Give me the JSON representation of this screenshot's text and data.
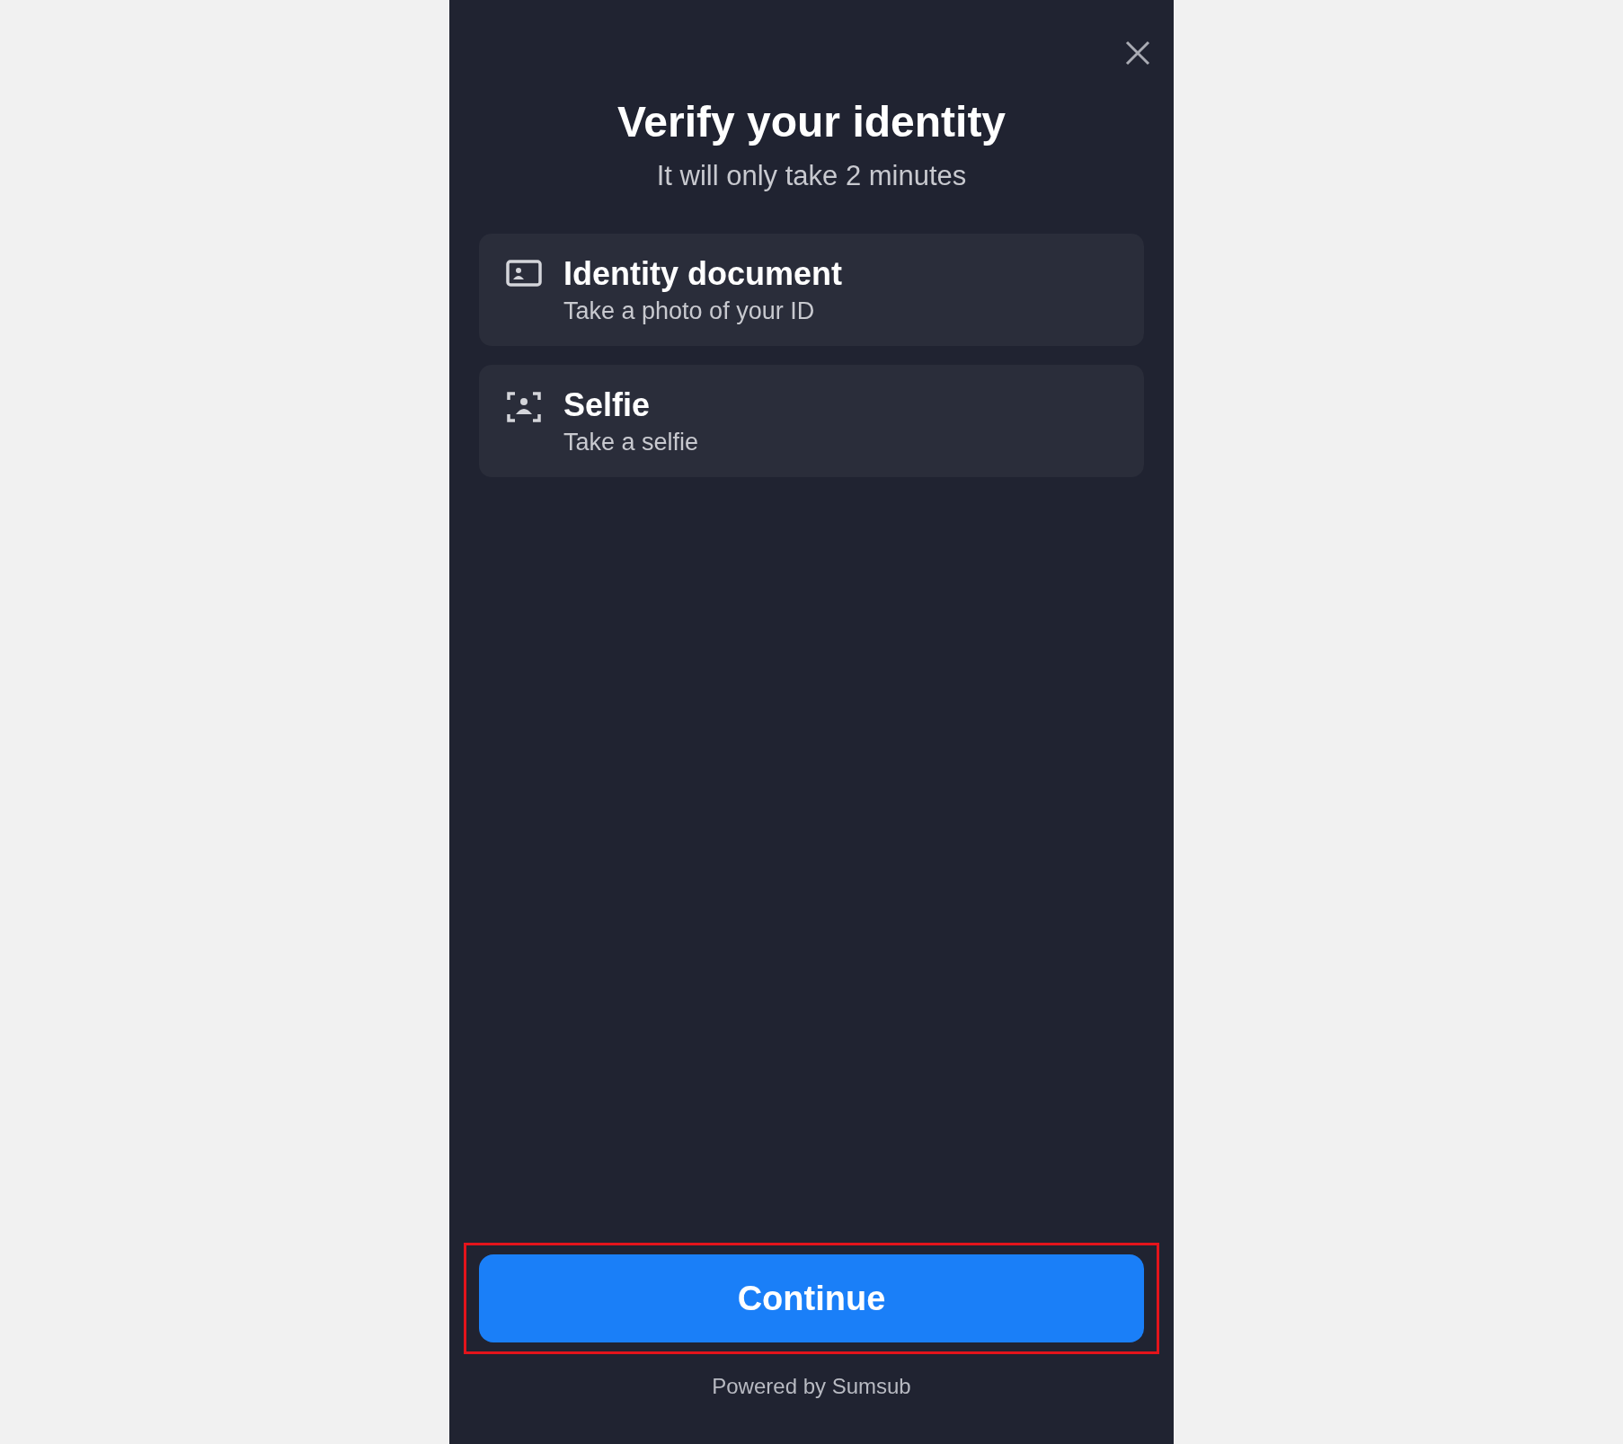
{
  "screen": {
    "title": "Verify your identity",
    "subtitle": "It will only take 2 minutes"
  },
  "steps": [
    {
      "kind": "document",
      "title": "Identity document",
      "subtitle": "Take a photo of your ID"
    },
    {
      "kind": "selfie",
      "title": "Selfie",
      "subtitle": "Take a selfie"
    }
  ],
  "primary_button": {
    "label": "Continue",
    "highlighted": true
  },
  "footer": "Powered by Sumsub"
}
